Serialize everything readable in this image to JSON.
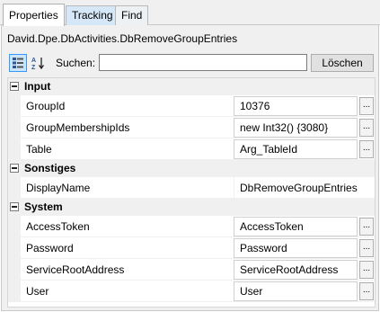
{
  "tabs": [
    {
      "label": "Properties"
    },
    {
      "label": "Tracking"
    },
    {
      "label": "Find"
    }
  ],
  "type_name": "David.Dpe.DbActivities.DbRemoveGroupEntries",
  "toolbar": {
    "categorized_icon": "categorized-icon",
    "alphabetical_icon": "sort-az-icon",
    "search_label": "Suchen:",
    "search_value": "",
    "clear_label": "Löschen"
  },
  "categories": [
    {
      "label": "Input",
      "rows": [
        {
          "name": "GroupId",
          "value": "10376",
          "boxed": true,
          "has_button": true
        },
        {
          "name": "GroupMembershipIds",
          "value": "new Int32() {3080}",
          "boxed": true,
          "has_button": true
        },
        {
          "name": "Table",
          "value": "Arg_TableId",
          "boxed": true,
          "has_button": true
        }
      ]
    },
    {
      "label": "Sonstiges",
      "rows": [
        {
          "name": "DisplayName",
          "value": "DbRemoveGroupEntries",
          "boxed": false,
          "has_button": false
        }
      ]
    },
    {
      "label": "System",
      "rows": [
        {
          "name": "AccessToken",
          "value": "AccessToken",
          "boxed": true,
          "has_button": true
        },
        {
          "name": "Password",
          "value": "Password",
          "boxed": true,
          "has_button": true
        },
        {
          "name": "ServiceRootAddress",
          "value": "ServiceRootAddress",
          "boxed": true,
          "has_button": true
        },
        {
          "name": "User",
          "value": "User",
          "boxed": true,
          "has_button": true
        }
      ]
    }
  ],
  "ellipsis_label": "...",
  "colors": {
    "tab_active_bg": "#ffffff",
    "tab_tracking_bg": "#d6e7f7",
    "category_bg": "#f0f0f0",
    "selected_tool_border": "#3399ff"
  }
}
